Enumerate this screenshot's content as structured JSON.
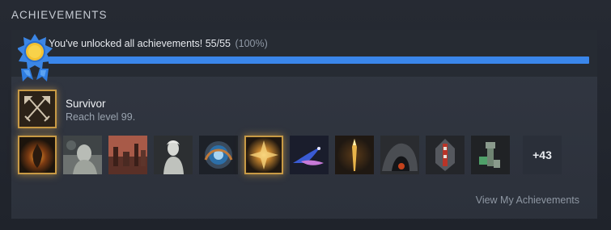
{
  "section": {
    "title": "ACHIEVEMENTS"
  },
  "progress": {
    "message": "You've unlocked all achievements! 55/55",
    "percent_text": "(100%)",
    "fraction": 1.0,
    "bar_color": "#3a86ea"
  },
  "featured": {
    "name": "Survivor",
    "description": "Reach level 99.",
    "icon": "crossed-blades-icon"
  },
  "icons": [
    {
      "name": "dark-flame-achievement-icon",
      "rare": true
    },
    {
      "name": "stone-figure-achievement-icon",
      "rare": false
    },
    {
      "name": "ruined-city-achievement-icon",
      "rare": false
    },
    {
      "name": "pale-statue-achievement-icon",
      "rare": false
    },
    {
      "name": "blue-orb-achievement-icon",
      "rare": false
    },
    {
      "name": "golden-burst-achievement-icon",
      "rare": true
    },
    {
      "name": "blue-dragon-achievement-icon",
      "rare": false
    },
    {
      "name": "golden-spear-achievement-icon",
      "rare": false
    },
    {
      "name": "dark-cavern-achievement-icon",
      "rare": false
    },
    {
      "name": "red-crystal-achievement-icon",
      "rare": false
    },
    {
      "name": "green-relic-achievement-icon",
      "rare": false
    }
  ],
  "more": {
    "label": "+43"
  },
  "footer": {
    "link_label": "View My Achievements"
  }
}
